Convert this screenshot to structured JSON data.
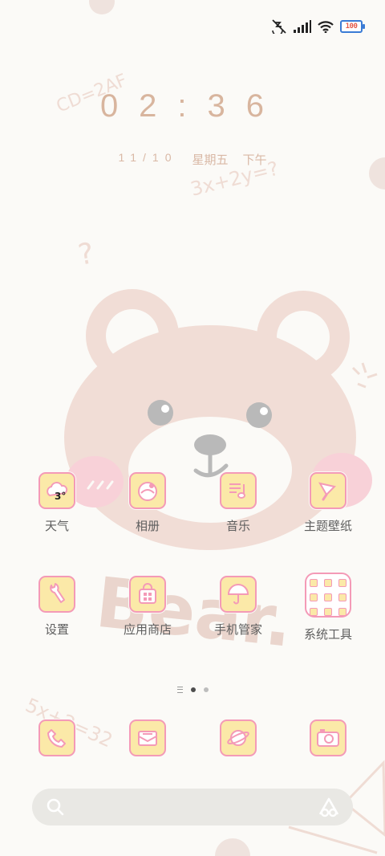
{
  "status_bar": {
    "icons": [
      "mute-vibrate-icon",
      "cellular-signal-icon",
      "wifi-icon",
      "battery-icon"
    ],
    "battery_level": "100"
  },
  "clock": {
    "time": "02:36",
    "date": "11/10",
    "weekday": "星期五",
    "period": "下午"
  },
  "apps": [
    {
      "label": "天气",
      "icon": "weather-icon",
      "temperature": "3°"
    },
    {
      "label": "相册",
      "icon": "gallery-icon"
    },
    {
      "label": "音乐",
      "icon": "music-icon"
    },
    {
      "label": "主题壁纸",
      "icon": "themes-icon"
    },
    {
      "label": "设置",
      "icon": "settings-icon"
    },
    {
      "label": "应用商店",
      "icon": "app-store-icon"
    },
    {
      "label": "手机管家",
      "icon": "security-icon"
    },
    {
      "label": "系统工具",
      "icon": "system-tools-folder-icon"
    }
  ],
  "dock": [
    {
      "icon": "phone-icon"
    },
    {
      "icon": "messages-icon"
    },
    {
      "icon": "browser-icon"
    },
    {
      "icon": "camera-icon"
    }
  ],
  "page_indicator": {
    "pages": 2,
    "current": 1
  },
  "search": {
    "icons": [
      "search-icon",
      "assistant-icon"
    ]
  },
  "wallpaper_text": {
    "word": "Bear.",
    "math_1": "CD=2AF",
    "math_2": "3x+2y=?",
    "math_3": "5x+2=32",
    "question": "?"
  },
  "colors": {
    "background": "#fbfaf7",
    "bear_brown": "#f1ddd6",
    "icon_border": "#f49ab7",
    "icon_fill": "#fbe9a8",
    "clock": "#d8b59e"
  }
}
